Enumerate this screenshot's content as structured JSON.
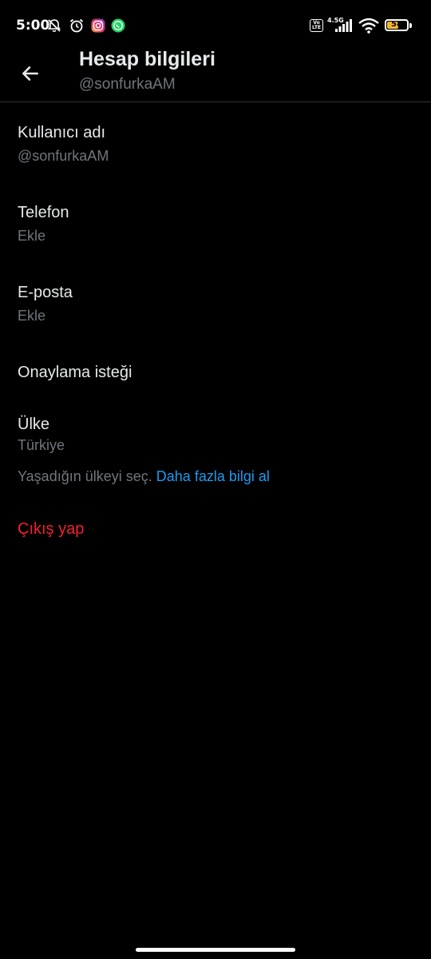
{
  "status_bar": {
    "time": "5:00",
    "network_label": "4.5G",
    "volte_label": "Vo LTE",
    "battery_level": "58",
    "battery_fraction": 0.58,
    "battery_color": "#f5b731",
    "icons": [
      "muted-notification-icon",
      "alarm-icon",
      "instagram-icon",
      "whatsapp-icon",
      "volte-icon",
      "signal-icon",
      "wifi-icon",
      "battery-icon"
    ]
  },
  "header": {
    "title": "Hesap bilgileri",
    "subtitle": "@sonfurkaAM",
    "back_icon": "arrow-left-icon"
  },
  "rows": [
    {
      "label": "Kullanıcı adı",
      "value": "@sonfurkaAM"
    },
    {
      "label": "Telefon",
      "value": "Ekle"
    },
    {
      "label": "E-posta",
      "value": "Ekle"
    },
    {
      "label": "Onaylama isteği"
    },
    {
      "label": "Ülke",
      "value": "Türkiye"
    }
  ],
  "country_help": {
    "text": "Yaşadığın ülkeyi seç.",
    "link": "Daha fazla bilgi al"
  },
  "logout_label": "Çıkış yap",
  "colors": {
    "background": "#000000",
    "primary_text": "#e7e9ea",
    "secondary_text": "#71767b",
    "link": "#1d9bf0",
    "danger": "#f4212e",
    "divider": "#2f3336"
  }
}
